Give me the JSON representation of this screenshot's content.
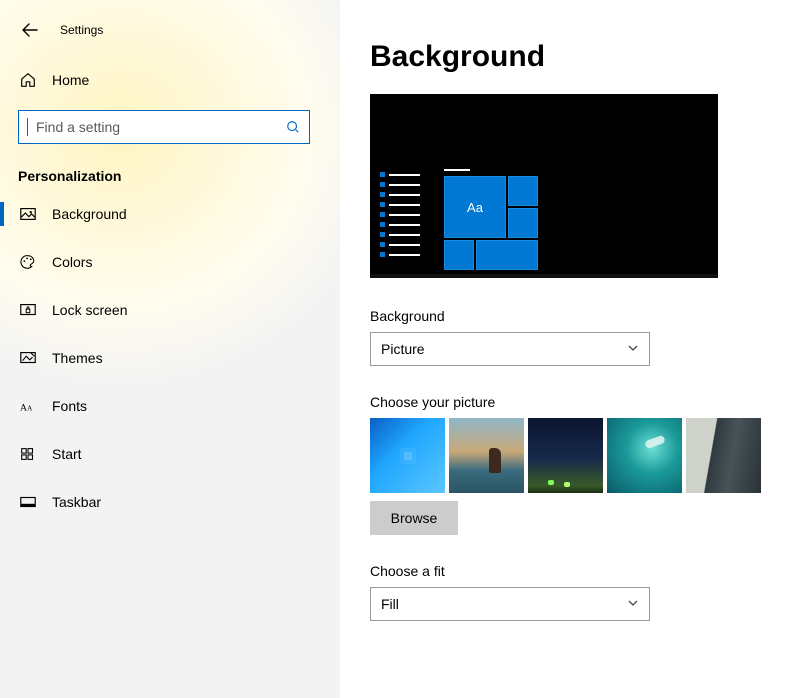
{
  "header": {
    "app_title": "Settings"
  },
  "sidebar": {
    "home_label": "Home",
    "search_placeholder": "Find a setting",
    "category_label": "Personalization",
    "items": [
      {
        "id": "background",
        "label": "Background",
        "active": true
      },
      {
        "id": "colors",
        "label": "Colors"
      },
      {
        "id": "lock-screen",
        "label": "Lock screen"
      },
      {
        "id": "themes",
        "label": "Themes"
      },
      {
        "id": "fonts",
        "label": "Fonts"
      },
      {
        "id": "start",
        "label": "Start"
      },
      {
        "id": "taskbar",
        "label": "Taskbar"
      }
    ]
  },
  "main": {
    "page_title": "Background",
    "preview_tile_text": "Aa",
    "background_label": "Background",
    "background_value": "Picture",
    "choose_picture_label": "Choose your picture",
    "browse_label": "Browse",
    "choose_fit_label": "Choose a fit",
    "fit_value": "Fill"
  }
}
